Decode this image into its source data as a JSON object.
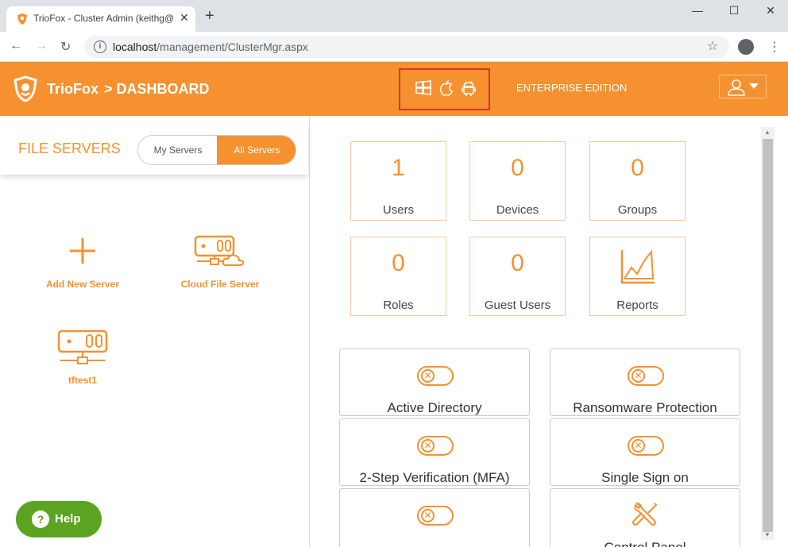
{
  "browser": {
    "tab_title": "TrioFox - Cluster Admin (keithg@",
    "tab_close": "✕",
    "new_tab": "+",
    "window_controls": {
      "minimize": "—",
      "maximize": "☐",
      "close": "✕"
    },
    "url_host": "localhost",
    "url_path": "/management/ClusterMgr.aspx",
    "nav": {
      "back": "←",
      "forward": "→",
      "reload": "↻",
      "star": "☆",
      "menu": "⋮"
    }
  },
  "header": {
    "brand": "TrioFox",
    "breadcrumb": "> DASHBOARD",
    "edition": "ENTERPRISE EDITION",
    "platform_icons": [
      "windows-icon",
      "apple-icon",
      "android-icon"
    ],
    "accent_color": "#f5912f",
    "highlight_color": "#d9342b"
  },
  "file_servers": {
    "title": "FILE SERVERS",
    "segment": {
      "my": "My Servers",
      "all": "All Servers",
      "selected": "All Servers"
    },
    "tiles": [
      {
        "label": "Add New Server",
        "icon": "plus-icon"
      },
      {
        "label": "Cloud File Server",
        "icon": "cloud-server-icon"
      },
      {
        "label": "tftest1",
        "icon": "server-icon"
      }
    ]
  },
  "help": {
    "label": "Help",
    "icon_text": "?",
    "color": "#5ba422"
  },
  "stats": [
    {
      "value": "1",
      "label": "Users"
    },
    {
      "value": "0",
      "label": "Devices"
    },
    {
      "value": "0",
      "label": "Groups"
    },
    {
      "value": "0",
      "label": "Roles"
    },
    {
      "value": "0",
      "label": "Guest Users"
    },
    {
      "value": "",
      "label": "Reports",
      "icon": "chart-icon"
    }
  ],
  "features": [
    {
      "label": "Active Directory",
      "icon": "toggle-off-icon"
    },
    {
      "label": "Ransomware Protection",
      "icon": "toggle-off-icon"
    },
    {
      "label": "2-Step Verification (MFA)",
      "icon": "toggle-off-icon"
    },
    {
      "label": "Single Sign on",
      "icon": "toggle-off-icon"
    },
    {
      "label": "",
      "icon": "toggle-off-icon"
    },
    {
      "label": "Control Panel",
      "icon": "tools-icon"
    }
  ]
}
